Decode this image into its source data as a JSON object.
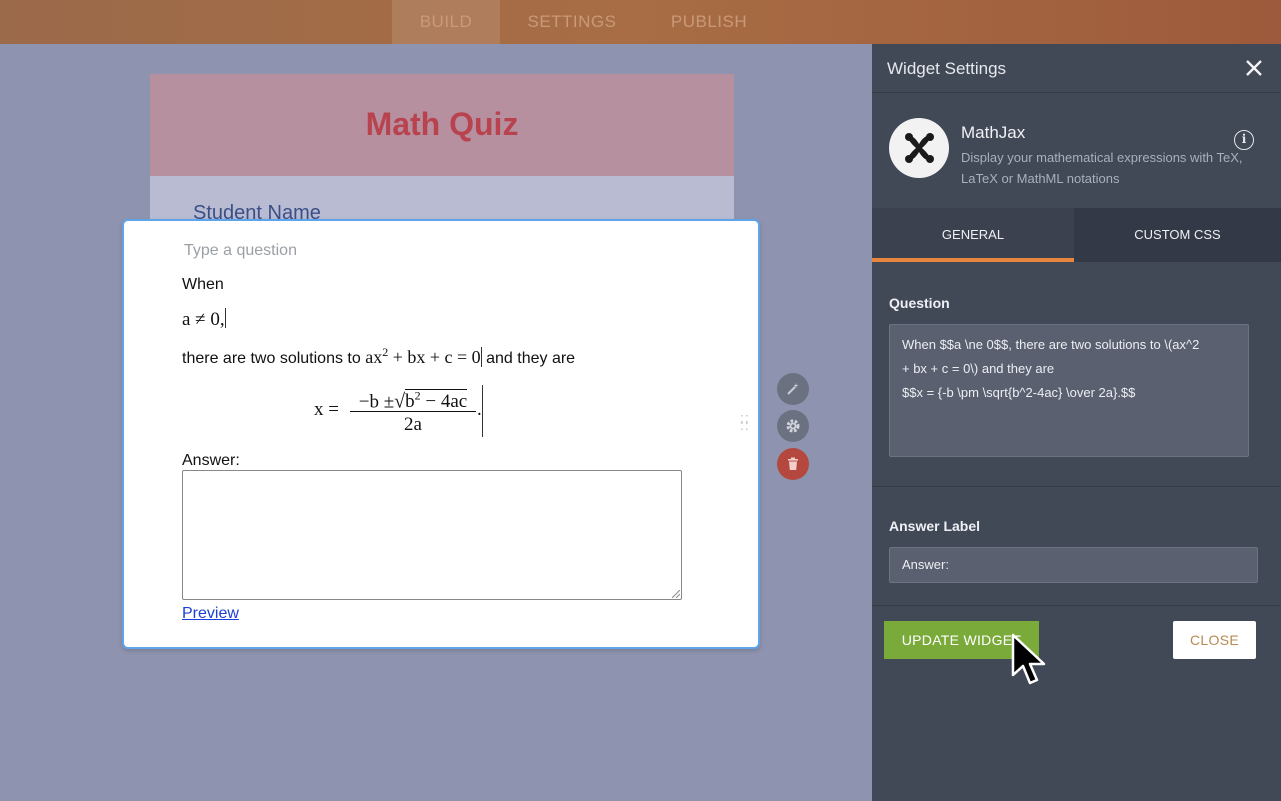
{
  "topbar": {
    "tabs": [
      "BUILD",
      "SETTINGS",
      "PUBLISH"
    ]
  },
  "form": {
    "title": "Math Quiz",
    "student_label": "Student Name"
  },
  "question": {
    "placeholder": "Type a question",
    "when": "When",
    "math_line1": "a ≠ 0,",
    "line2_pre": "there are two solutions to",
    "line2_math": "ax",
    "line2_sup": "2",
    "line2_math_rest": " + bx + c = 0",
    "line2_post": "and they are",
    "formula_lhs": "x =",
    "formula_num_pre": "−b ±",
    "formula_sqrt_b": "b",
    "formula_sqrt_sup": "2",
    "formula_sqrt_rest": " − 4ac",
    "formula_den": "2a",
    "formula_end": ".",
    "answer_label": "Answer:",
    "preview_link": "Preview"
  },
  "panel": {
    "title": "Widget Settings",
    "widget_name": "MathJax",
    "widget_desc": "Display your mathematical expressions with TeX, LaTeX or MathML notations",
    "tabs": [
      "GENERAL",
      "CUSTOM CSS"
    ],
    "question_label": "Question",
    "question_value_line1": "When $$a \\ne 0$$, there are two solutions to \\(ax^2",
    "question_value_line2": "+ bx + c = 0\\) and they are",
    "question_value_line3": "$$x = {-b \\pm \\sqrt{b^2-4ac} \\over 2a}.$$",
    "answer_label_title": "Answer Label",
    "answer_label_value": "Answer:",
    "update_button": "UPDATE WIDGET",
    "close_button": "CLOSE"
  },
  "colors": {
    "accent_orange": "#e8853f",
    "update_green": "#7aab3a",
    "title_red": "#b8434f",
    "selection_blue": "#5fa4e8"
  },
  "icons": [
    "magic-wand-icon",
    "gear-icon",
    "trash-icon",
    "close-icon",
    "info-icon",
    "mathjax-logo-icon",
    "cursor-icon"
  ]
}
